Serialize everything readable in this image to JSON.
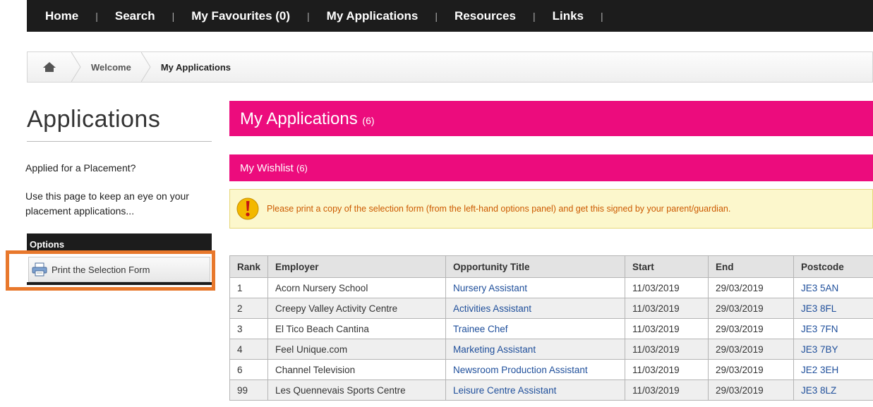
{
  "topnav": {
    "items": [
      "Home",
      "Search",
      "My Favourites (0)",
      "My Applications",
      "Resources",
      "Links"
    ]
  },
  "breadcrumb": {
    "items": [
      "Welcome",
      "My Applications"
    ]
  },
  "sidebar": {
    "title": "Applications",
    "question": "Applied for a Placement?",
    "description": "Use this page to keep an eye on your placement applications...",
    "options_label": "Options",
    "print_label": "Print the Selection Form"
  },
  "main": {
    "applications_title": "My Applications",
    "applications_count": "(6)",
    "wishlist_title": "My Wishlist",
    "wishlist_count": "(6)",
    "notice": "Please print a copy of the selection form (from the left-hand options panel) and get this signed by your parent/guardian."
  },
  "table": {
    "headers": [
      "Rank",
      "Employer",
      "Opportunity Title",
      "Start",
      "End",
      "Postcode"
    ],
    "rows": [
      [
        "1",
        "Acorn Nursery School",
        "Nursery Assistant",
        "11/03/2019",
        "29/03/2019",
        "JE3 5AN"
      ],
      [
        "2",
        "Creepy Valley Activity Centre",
        "Activities Assistant",
        "11/03/2019",
        "29/03/2019",
        "JE3 8FL"
      ],
      [
        "3",
        "El Tico Beach Cantina",
        "Trainee Chef",
        "11/03/2019",
        "29/03/2019",
        "JE3 7FN"
      ],
      [
        "4",
        "Feel Unique.com",
        "Marketing Assistant",
        "11/03/2019",
        "29/03/2019",
        "JE3 7BY"
      ],
      [
        "6",
        "Channel Television",
        "Newsroom Production Assistant",
        "11/03/2019",
        "29/03/2019",
        "JE2 3EH"
      ],
      [
        "99",
        "Les Quennevais Sports Centre",
        "Leisure Centre Assistant",
        "11/03/2019",
        "29/03/2019",
        "JE3 8LZ"
      ]
    ]
  },
  "colors": {
    "accent_pink": "#ec0c7d",
    "nav_dark": "#1c1c1c",
    "highlight_orange": "#e8782c",
    "link_blue": "#1f4f9b",
    "notice_text": "#cc5a00"
  },
  "icons": [
    "home-icon",
    "printer-icon",
    "warning-icon"
  ]
}
